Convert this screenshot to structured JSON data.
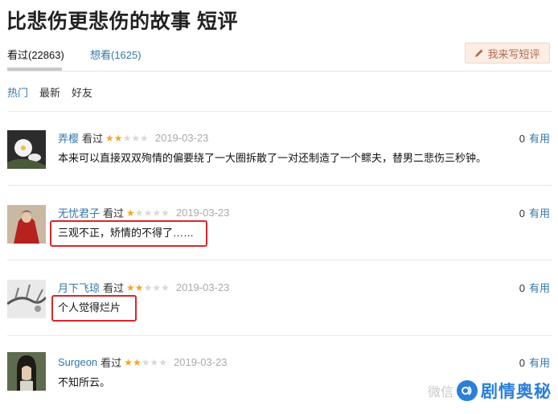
{
  "page": {
    "title": "比悲伤更悲伤的故事 短评"
  },
  "tabs": {
    "seen_label": "看过(22863)",
    "want_label": "想看(1625)"
  },
  "write_button": {
    "label": "我来写短评",
    "icon": "pencil-icon"
  },
  "filters": {
    "hot": "热门",
    "latest": "最新",
    "friends": "好友"
  },
  "comments": [
    {
      "user": "弄樱",
      "status": "看过",
      "rating": 2,
      "date": "2019-03-23",
      "votes": "0",
      "useful_label": "有用",
      "text": "本来可以直接双双殉情的偏要绕了一大圈拆散了一对还制造了一个鳏夫，替男二悲伤三秒钟。"
    },
    {
      "user": "无忧君子",
      "status": "看过",
      "rating": 1,
      "date": "2019-03-23",
      "votes": "0",
      "useful_label": "有用",
      "text": "三观不正，矫情的不得了……"
    },
    {
      "user": "月下飞琼",
      "status": "看过",
      "rating": 2,
      "date": "2019-03-23",
      "votes": "0",
      "useful_label": "有用",
      "text": "个人觉得烂片"
    },
    {
      "user": "Surgeon",
      "status": "看过",
      "rating": 2,
      "date": "2019-03-23",
      "votes": "0",
      "useful_label": "有用",
      "text": "不知所云。"
    }
  ],
  "watermark": {
    "faint": "微信",
    "brand": "剧情奥秘"
  },
  "colors": {
    "link": "#3377aa",
    "star": "#f5a623",
    "highlight": "#d9262a",
    "button_bg": "#fcede5",
    "button_text": "#b56b4e"
  }
}
